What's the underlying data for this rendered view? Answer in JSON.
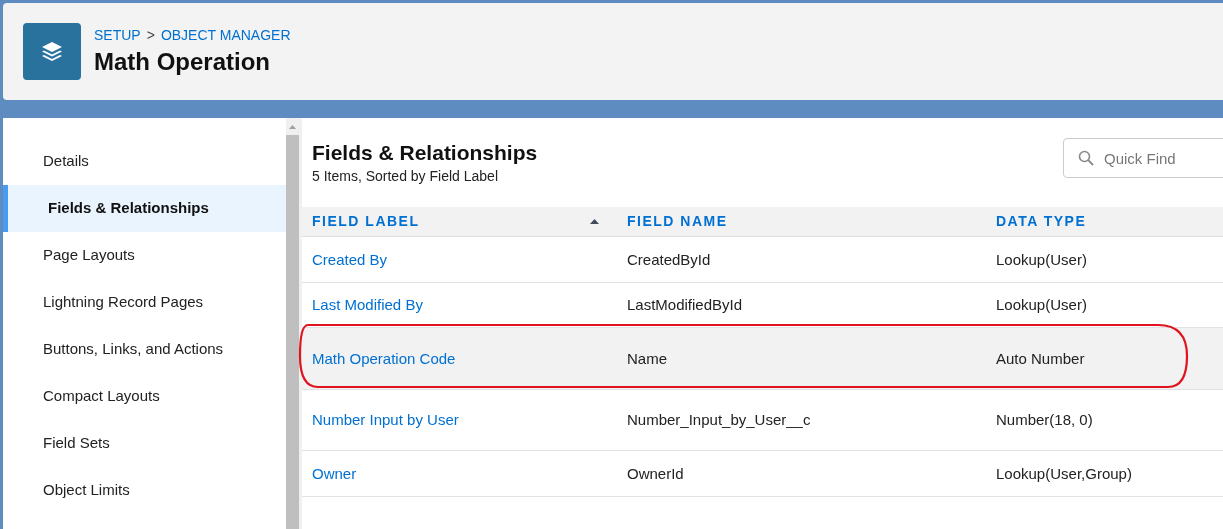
{
  "header": {
    "breadcrumb": [
      "SETUP",
      "OBJECT MANAGER"
    ],
    "separator": ">",
    "title": "Math Operation"
  },
  "sidebar": {
    "items": [
      {
        "label": "Details",
        "selected": false
      },
      {
        "label": "Fields & Relationships",
        "selected": true
      },
      {
        "label": "Page Layouts",
        "selected": false
      },
      {
        "label": "Lightning Record Pages",
        "selected": false
      },
      {
        "label": "Buttons, Links, and Actions",
        "selected": false
      },
      {
        "label": "Compact Layouts",
        "selected": false
      },
      {
        "label": "Field Sets",
        "selected": false
      },
      {
        "label": "Object Limits",
        "selected": false
      }
    ]
  },
  "main": {
    "title": "Fields & Relationships",
    "subtitle": "5 Items, Sorted by Field Label",
    "search": {
      "placeholder": "Quick Find"
    }
  },
  "table": {
    "columns": [
      {
        "label": "FIELD LABEL",
        "sorted": true
      },
      {
        "label": "FIELD NAME",
        "sorted": false
      },
      {
        "label": "DATA TYPE",
        "sorted": false
      }
    ],
    "rows": [
      {
        "cells": [
          "Created By",
          "CreatedById",
          "Lookup(User)"
        ],
        "selected": false
      },
      {
        "cells": [
          "Last Modified By",
          "LastModifiedById",
          "Lookup(User)"
        ],
        "selected": false
      },
      {
        "cells": [
          "Math Operation Code",
          "Name",
          "Auto Number"
        ],
        "selected": true
      },
      {
        "cells": [
          "Number Input by User",
          "Number_Input_by_User__c",
          "Number(18, 0)"
        ],
        "selected": false
      },
      {
        "cells": [
          "Owner",
          "OwnerId",
          "Lookup(User,Group)"
        ],
        "selected": false
      }
    ]
  }
}
